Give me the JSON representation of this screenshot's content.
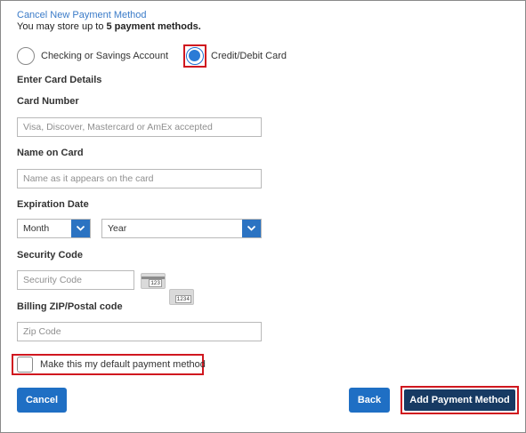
{
  "header": {
    "cancel_link": "Cancel New Payment Method",
    "limit_prefix": "You may store up to ",
    "limit_bold": "5 payment methods."
  },
  "payment_type": {
    "options": [
      {
        "label": "Checking or Savings Account",
        "selected": false
      },
      {
        "label": "Credit/Debit Card",
        "selected": true
      }
    ]
  },
  "form": {
    "section_title": "Enter Card Details",
    "card_number": {
      "label": "Card Number",
      "placeholder": "Visa, Discover, Mastercard or AmEx accepted",
      "value": ""
    },
    "name_on_card": {
      "label": "Name on Card",
      "placeholder": "Name as it appears on the card",
      "value": ""
    },
    "expiration": {
      "label": "Expiration Date",
      "month": "Month",
      "year": "Year"
    },
    "security_code": {
      "label": "Security Code",
      "placeholder": "Security Code",
      "value": "",
      "card_icons": [
        "123",
        "1234"
      ]
    },
    "zip": {
      "label": "Billing ZIP/Postal code",
      "placeholder": "Zip Code",
      "value": ""
    },
    "default_checkbox": {
      "label": "Make this my default payment method",
      "checked": false
    }
  },
  "buttons": {
    "cancel": "Cancel",
    "back": "Back",
    "add": "Add Payment Method"
  },
  "colors": {
    "link": "#3a7bc8",
    "primary_button": "#1f6fc4",
    "submit_button": "#173a63",
    "highlight": "#d0171f"
  }
}
